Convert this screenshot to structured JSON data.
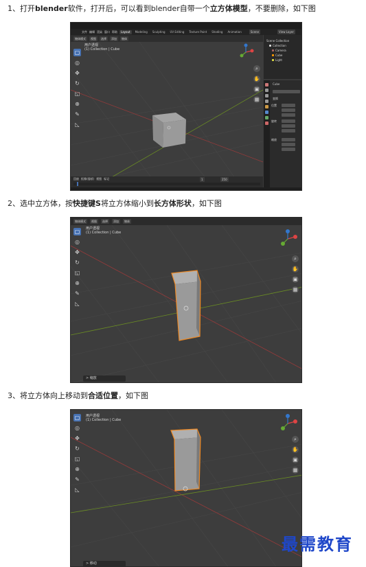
{
  "steps": [
    {
      "pre": "1、打开",
      "bold1": "blender",
      "mid": "软件，打开后，可以看到blender自带一个",
      "bold2": "立方体模型",
      "post": "，不要删除，如下图"
    },
    {
      "pre": "2、选中立方体，按",
      "bold1": "快捷键S",
      "mid": "将立方体缩小到",
      "bold2": "长方体形状",
      "post": "，如下图"
    },
    {
      "pre": "3、将立方体向上移动到",
      "bold1": "合适位置",
      "mid": "，如下图",
      "bold2": "",
      "post": ""
    }
  ],
  "shot1": {
    "menu": [
      "文件",
      "编辑",
      "渲染",
      "窗口",
      "帮助"
    ],
    "workspaces": [
      "Layout",
      "Modeling",
      "Sculpting",
      "UV Editing",
      "Texture Paint",
      "Shading",
      "Animation"
    ],
    "active_workspace": "Layout",
    "scene": "Scene",
    "view_layer": "View Layer",
    "viewport_info_1": "用户透视",
    "viewport_info_2": "(1) Collection | Cube",
    "outliner_items": [
      "Scene Collection",
      "Collection",
      "Camera",
      "Cube",
      "Light"
    ],
    "props_object_name": "Cube",
    "props_section": "变换",
    "props_labels": [
      "位置",
      "旋转",
      "缩放"
    ],
    "timeline_start": "1",
    "timeline_end": "250",
    "timeline_menu": [
      "回放",
      "抠像(插帧)",
      "视图",
      "标记"
    ]
  },
  "shot2": {
    "header_buttons": [
      "物体模式",
      "视图",
      "选择",
      "添加",
      "物体"
    ],
    "viewport_info_1": "用户透视",
    "viewport_info_2": "(1) Collection | Cube",
    "operator_panel": "> 缩放"
  },
  "shot3": {
    "viewport_info_1": "用户透视",
    "viewport_info_2": "(1) Collection | Cube",
    "operator_panel": "> 移动"
  },
  "watermark": "最需教育",
  "colors": {
    "viewport_bg": "#3d3d3d",
    "grid": "#474747",
    "axis_x": "#9a3a3a",
    "axis_y": "#6b8e23",
    "selection": "#f08a24",
    "active_tool": "#4772b3",
    "watermark": "#1f47c9"
  }
}
